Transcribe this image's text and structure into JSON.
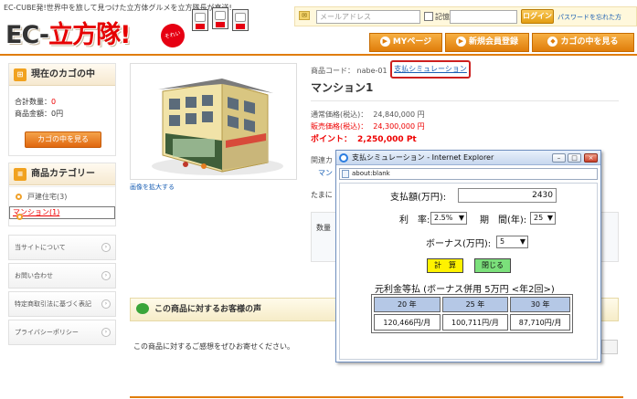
{
  "header": {
    "tagline": "EC-CUBE発!世界中を旅して見つけた立方体グルメを立方隊長が直送!",
    "logo_left": "EC-",
    "logo_right": "立方隊!",
    "logo_badge": "それいけ!",
    "email_placeholder": "メールアドレス",
    "remember_label": "記憶",
    "login_label": "ログイン",
    "forgot_label": "パスワードを忘れた方"
  },
  "nav": {
    "mypage": "MYページ",
    "register": "新規会員登録",
    "cart": "カゴの中を見る"
  },
  "sidebar": {
    "cart_title": "現在のカゴの中",
    "total_qty_label": "合計数量：",
    "total_qty_value": "0",
    "total_amount_label": "商品金額：",
    "total_amount_value": "0円",
    "cart_button": "カゴの中を見る",
    "category_title": "商品カテゴリー",
    "categories": [
      {
        "label": "戸建住宅(3)"
      },
      {
        "label": "マンション(1)"
      }
    ],
    "links": [
      {
        "label": "当サイトについて"
      },
      {
        "label": "お問い合わせ"
      },
      {
        "label": "特定商取引法に基づく表記"
      },
      {
        "label": "プライバシーポリシー"
      }
    ]
  },
  "product": {
    "code": "商品コード： nabe-01",
    "sim_link": "支払シミュレーション",
    "name": "マンション1",
    "regular_label": "通常価格(税込)：",
    "regular_value": "24,840,000 円",
    "sale_label": "販売価格(税込)：",
    "sale_value": "24,300,000 円",
    "point_label": "ポイント：",
    "point_value": "2,250,000 Pt",
    "related_label": "関連カ",
    "related_link": "マン",
    "tama": "たまに",
    "qty_label": "数量",
    "zoom_label": "画像を拡大する"
  },
  "review": {
    "title": "この商品に対するお客様の声",
    "placeholder": "この商品に対するご感想をぜひお寄せください。"
  },
  "popup": {
    "title": "支払シミュレーション - Internet Explorer",
    "address": "about:blank",
    "amount_label": "支払額(万円):",
    "amount_value": "2430",
    "rate_label": "利　率:",
    "rate_value": "2.5%",
    "period_label": "期　間(年):",
    "period_value": "25",
    "bonus_label": "ボーナス(万円):",
    "bonus_value": "5",
    "calc_button": "計　算",
    "close_button": "閉じる",
    "result_title": "元利金等払 (ボーナス併用 5万円 <年2回>)",
    "result_headers": [
      "20 年",
      "25 年",
      "30 年"
    ],
    "result_values": [
      "120,466円/月",
      "100,711円/月",
      "87,710円/月"
    ]
  }
}
